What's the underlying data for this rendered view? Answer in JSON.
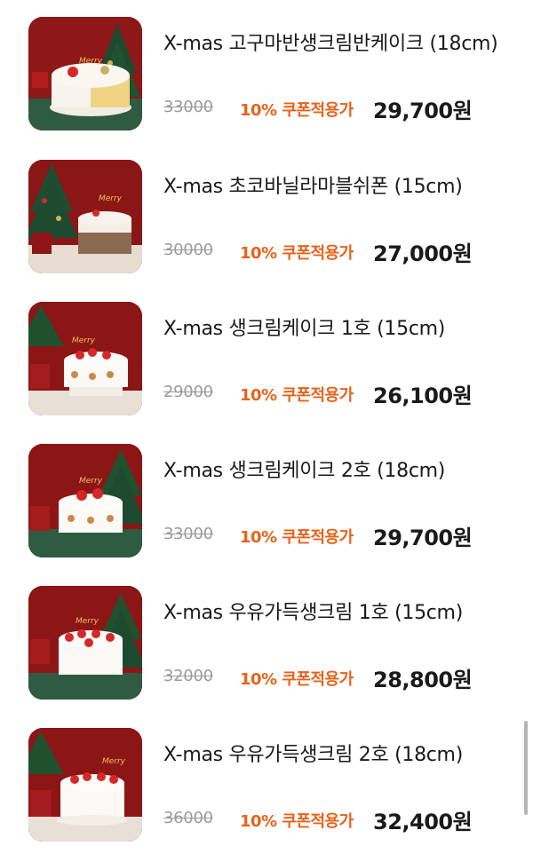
{
  "colors": {
    "coupon": "#e8621a",
    "strike": "#9a9a9a",
    "text": "#1a1a1a"
  },
  "products": [
    {
      "title": "X-mas 고구마반생크림반케이크 (18cm)",
      "original_price": "33000",
      "coupon_label": "10% 쿠폰적용가",
      "final_price": "29,700원",
      "image_icon": "cake-sweet-potato-half-cream-icon"
    },
    {
      "title": "X-mas 초코바닐라마블쉬폰 (15cm)",
      "original_price": "30000",
      "coupon_label": "10% 쿠폰적용가",
      "final_price": "27,000원",
      "image_icon": "cake-choco-vanilla-chiffon-icon"
    },
    {
      "title": "X-mas 생크림케이크 1호 (15cm)",
      "original_price": "29000",
      "coupon_label": "10% 쿠폰적용가",
      "final_price": "26,100원",
      "image_icon": "cake-fresh-cream-1-icon"
    },
    {
      "title": "X-mas 생크림케이크 2호 (18cm)",
      "original_price": "33000",
      "coupon_label": "10% 쿠폰적용가",
      "final_price": "29,700원",
      "image_icon": "cake-fresh-cream-2-icon"
    },
    {
      "title": "X-mas 우유가득생크림 1호 (15cm)",
      "original_price": "32000",
      "coupon_label": "10% 쿠폰적용가",
      "final_price": "28,800원",
      "image_icon": "cake-milk-cream-1-icon"
    },
    {
      "title": "X-mas 우유가득생크림 2호 (18cm)",
      "original_price": "36000",
      "coupon_label": "10% 쿠폰적용가",
      "final_price": "32,400원",
      "image_icon": "cake-milk-cream-2-icon"
    }
  ]
}
